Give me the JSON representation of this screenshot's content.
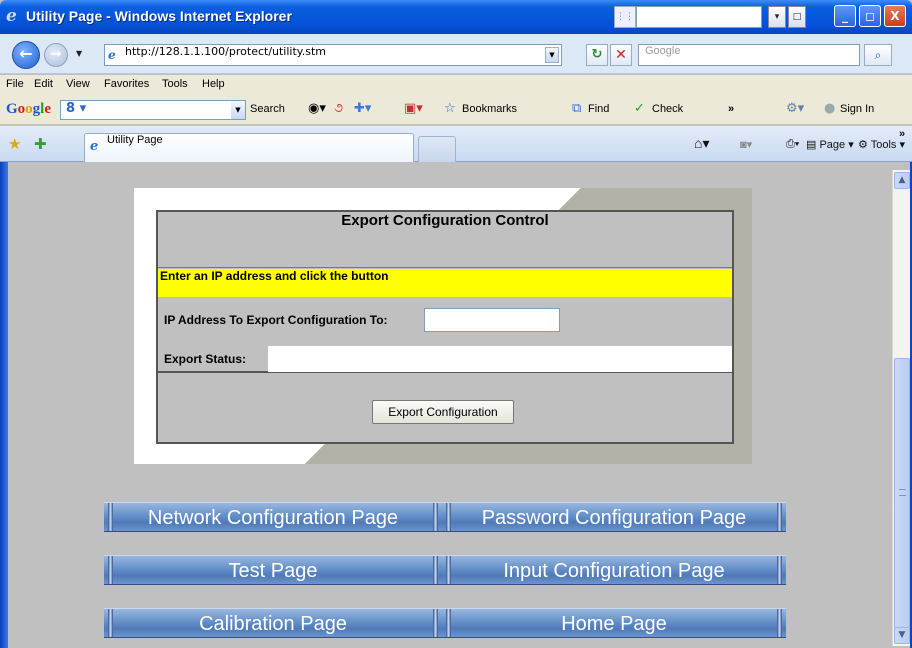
{
  "window": {
    "title": "Utility Page - Windows Internet Explorer",
    "min_label": "_",
    "max_label": "◻",
    "close_label": "X"
  },
  "address_bar": {
    "url": "http://128.1.1.100/protect/utility.stm",
    "search_placeholder": "Google"
  },
  "menu": [
    "File",
    "Edit",
    "View",
    "Favorites",
    "Tools",
    "Help"
  ],
  "google_toolbar": {
    "logo": "Google",
    "search_label": "Search",
    "bookmarks_label": "Bookmarks",
    "find_label": "Find",
    "check_label": "Check",
    "more_label": "»",
    "signin_label": "Sign In"
  },
  "tabs": {
    "active_tab": "Utility Page",
    "page_menu": "Page",
    "tools_menu": "Tools",
    "more_label": "»"
  },
  "panel": {
    "title": "Export Configuration Control",
    "instruction": "Enter an IP address and click the button",
    "ip_label": "IP Address To Export Configuration To:",
    "ip_value": "",
    "status_label": "Export Status:",
    "status_value": "",
    "export_button": "Export Configuration"
  },
  "nav_buttons": [
    {
      "label": "Network Configuration Page"
    },
    {
      "label": "Password Configuration Page"
    },
    {
      "label": "Test Page"
    },
    {
      "label": "Input Configuration Page"
    },
    {
      "label": "Calibration Page"
    },
    {
      "label": "Home Page"
    }
  ]
}
